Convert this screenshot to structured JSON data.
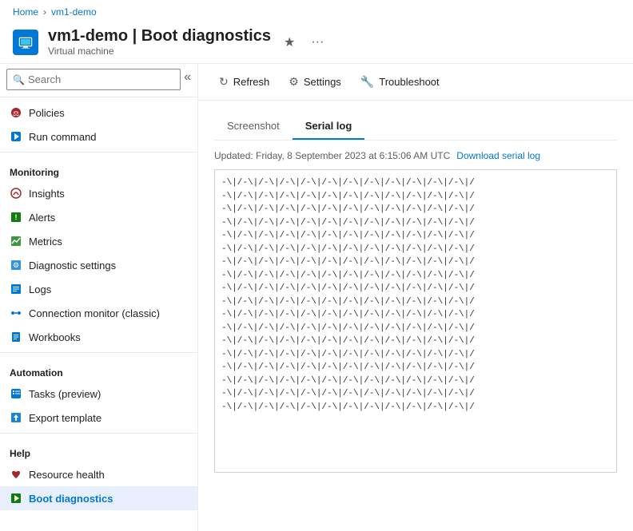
{
  "breadcrumb": {
    "home": "Home",
    "separator": "›",
    "current": "vm1-demo"
  },
  "header": {
    "title": "vm1-demo | Boot diagnostics",
    "subtitle": "Virtual machine",
    "star_label": "★",
    "more_label": "···"
  },
  "toolbar": {
    "refresh_label": "Refresh",
    "settings_label": "Settings",
    "troubleshoot_label": "Troubleshoot"
  },
  "sidebar": {
    "search_placeholder": "Search",
    "items_top": [
      {
        "id": "policies",
        "label": "Policies",
        "icon": "policy-icon"
      },
      {
        "id": "run-command",
        "label": "Run command",
        "icon": "run-icon"
      }
    ],
    "sections": [
      {
        "label": "Monitoring",
        "items": [
          {
            "id": "insights",
            "label": "Insights",
            "icon": "insights-icon"
          },
          {
            "id": "alerts",
            "label": "Alerts",
            "icon": "alerts-icon"
          },
          {
            "id": "metrics",
            "label": "Metrics",
            "icon": "metrics-icon"
          },
          {
            "id": "diagnostic-settings",
            "label": "Diagnostic settings",
            "icon": "diag-icon"
          },
          {
            "id": "logs",
            "label": "Logs",
            "icon": "logs-icon"
          },
          {
            "id": "connection-monitor",
            "label": "Connection monitor (classic)",
            "icon": "conn-icon"
          },
          {
            "id": "workbooks",
            "label": "Workbooks",
            "icon": "workbooks-icon"
          }
        ]
      },
      {
        "label": "Automation",
        "items": [
          {
            "id": "tasks",
            "label": "Tasks (preview)",
            "icon": "tasks-icon"
          },
          {
            "id": "export-template",
            "label": "Export template",
            "icon": "export-icon"
          }
        ]
      },
      {
        "label": "Help",
        "items": [
          {
            "id": "resource-health",
            "label": "Resource health",
            "icon": "health-icon"
          },
          {
            "id": "boot-diagnostics",
            "label": "Boot diagnostics",
            "icon": "boot-icon",
            "active": true
          }
        ]
      }
    ]
  },
  "tabs": [
    {
      "id": "screenshot",
      "label": "Screenshot",
      "active": false
    },
    {
      "id": "serial-log",
      "label": "Serial log",
      "active": true
    }
  ],
  "content": {
    "updated_text": "Updated: Friday, 8 September 2023 at 6:15:06 AM UTC",
    "download_label": "Download serial log",
    "log_lines": [
      "-\\|/-\\|/-\\|/-\\|/-\\|/-\\|/-\\|/-\\|/-\\|/-\\|/-\\|/-\\|/",
      "-\\|/-\\|/-\\|/-\\|/-\\|/-\\|/-\\|/-\\|/-\\|/-\\|/-\\|/-\\|/",
      "-\\|/-\\|/-\\|/-\\|/-\\|/-\\|/-\\|/-\\|/-\\|/-\\|/-\\|/-\\|/",
      "-\\|/-\\|/-\\|/-\\|/-\\|/-\\|/-\\|/-\\|/-\\|/-\\|/-\\|/-\\|/",
      "-\\|/-\\|/-\\|/-\\|/-\\|/-\\|/-\\|/-\\|/-\\|/-\\|/-\\|/-\\|/",
      "-\\|/-\\|/-\\|/-\\|/-\\|/-\\|/-\\|/-\\|/-\\|/-\\|/-\\|/-\\|/",
      "-\\|/-\\|/-\\|/-\\|/-\\|/-\\|/-\\|/-\\|/-\\|/-\\|/-\\|/-\\|/",
      "-\\|/-\\|/-\\|/-\\|/-\\|/-\\|/-\\|/-\\|/-\\|/-\\|/-\\|/-\\|/",
      "-\\|/-\\|/-\\|/-\\|/-\\|/-\\|/-\\|/-\\|/-\\|/-\\|/-\\|/-\\|/",
      "-\\|/-\\|/-\\|/-\\|/-\\|/-\\|/-\\|/-\\|/-\\|/-\\|/-\\|/-\\|/",
      "-\\|/-\\|/-\\|/-\\|/-\\|/-\\|/-\\|/-\\|/-\\|/-\\|/-\\|/-\\|/",
      "-\\|/-\\|/-\\|/-\\|/-\\|/-\\|/-\\|/-\\|/-\\|/-\\|/-\\|/-\\|/",
      "-\\|/-\\|/-\\|/-\\|/-\\|/-\\|/-\\|/-\\|/-\\|/-\\|/-\\|/-\\|/",
      "-\\|/-\\|/-\\|/-\\|/-\\|/-\\|/-\\|/-\\|/-\\|/-\\|/-\\|/-\\|/",
      "-\\|/-\\|/-\\|/-\\|/-\\|/-\\|/-\\|/-\\|/-\\|/-\\|/-\\|/-\\|/",
      "-\\|/-\\|/-\\|/-\\|/-\\|/-\\|/-\\|/-\\|/-\\|/-\\|/-\\|/-\\|/",
      "-\\|/-\\|/-\\|/-\\|/-\\|/-\\|/-\\|/-\\|/-\\|/-\\|/-\\|/-\\|/",
      "-\\|/-\\|/-\\|/-\\|/-\\|/-\\|/-\\|/-\\|/-\\|/-\\|/-\\|/-\\|/"
    ]
  }
}
